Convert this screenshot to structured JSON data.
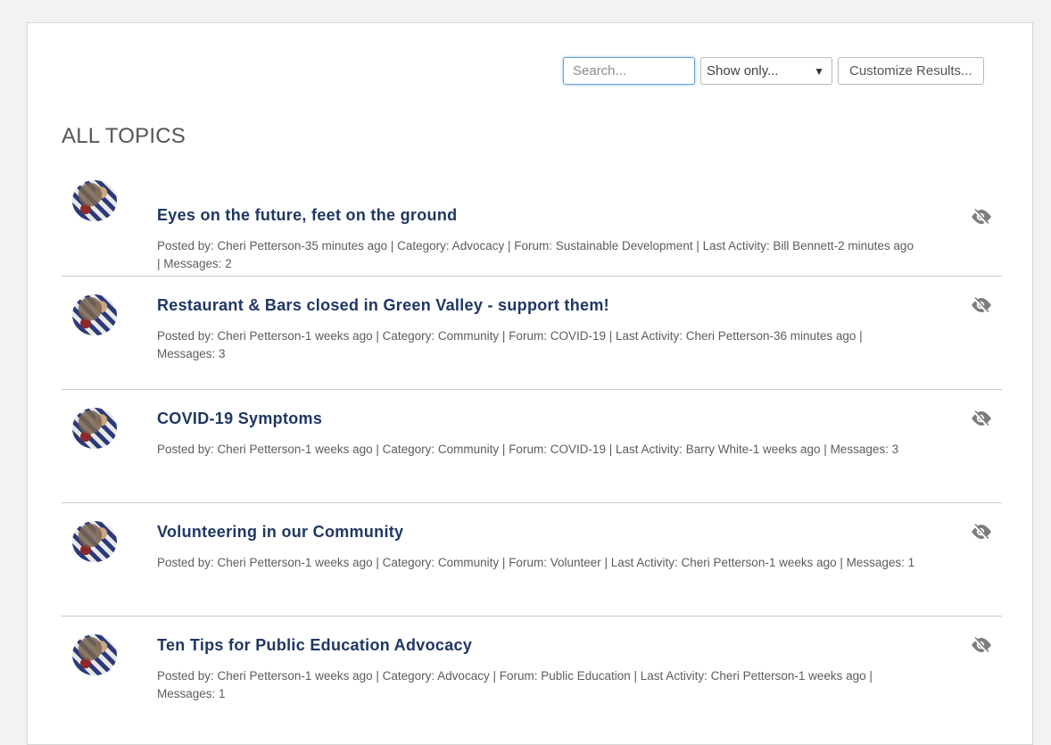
{
  "toolbar": {
    "search_placeholder": "Search...",
    "show_only_label": "Show only...",
    "show_only_caret": "▼",
    "customize_label": "Customize Results..."
  },
  "heading": "ALL TOPICS",
  "topics": [
    {
      "title": "Eyes on the future, feet on the ground",
      "meta": "Posted by: Cheri Petterson-35 minutes ago | Category: Advocacy | Forum: Sustainable Development | Last Activity: Bill Bennett-2 minutes ago | Messages: 2"
    },
    {
      "title": "Restaurant & Bars closed in Green Valley - support them!",
      "meta": "Posted by: Cheri Petterson-1 weeks ago | Category: Community | Forum: COVID-19 | Last Activity: Cheri Petterson-36 minutes ago | Messages: 3"
    },
    {
      "title": "COVID-19 Symptoms",
      "meta": "Posted by: Cheri Petterson-1 weeks ago | Category: Community | Forum: COVID-19 | Last Activity: Barry White-1 weeks ago | Messages: 3"
    },
    {
      "title": "Volunteering in our Community",
      "meta": "Posted by: Cheri Petterson-1 weeks ago | Category: Community | Forum: Volunteer | Last Activity: Cheri Petterson-1 weeks ago | Messages: 1"
    },
    {
      "title": "Ten Tips for Public Education Advocacy",
      "meta": "Posted by: Cheri Petterson-1 weeks ago | Category: Advocacy | Forum: Public Education | Last Activity: Cheri Petterson-1 weeks ago | Messages: 1"
    }
  ],
  "icons": {
    "avatar": "user-avatar",
    "watch": "eye-slash-icon"
  },
  "colors": {
    "title": "#1f3763",
    "meta": "#5c5c5c",
    "search_focus": "#6a9fd8"
  }
}
